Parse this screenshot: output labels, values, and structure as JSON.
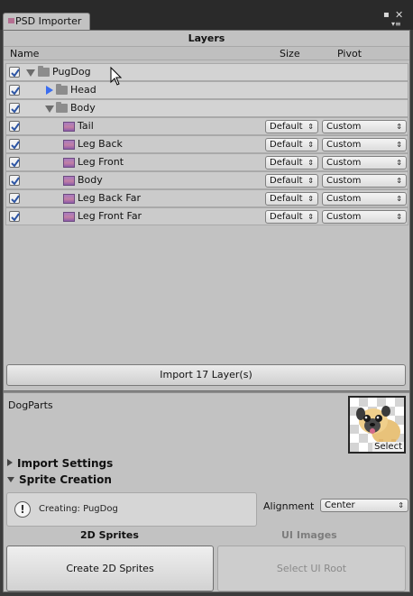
{
  "window": {
    "tab_title": "PSD Importer",
    "menu_icon": "dropdown-menu-icon",
    "maximize_icon": "maximize-icon",
    "close_icon": "close-icon"
  },
  "layers_panel": {
    "title": "Layers",
    "columns": {
      "name": "Name",
      "size": "Size",
      "pivot": "Pivot"
    },
    "rows": [
      {
        "label": "PugDog",
        "checked": true,
        "type": "group",
        "expanded": true
      },
      {
        "label": "Head",
        "checked": true,
        "type": "group",
        "expanded": false
      },
      {
        "label": "Body",
        "checked": true,
        "type": "group",
        "expanded": true
      },
      {
        "label": "Tail",
        "checked": true,
        "type": "layer",
        "size": "Default",
        "pivot": "Custom"
      },
      {
        "label": "Leg Back",
        "checked": true,
        "type": "layer",
        "size": "Default",
        "pivot": "Custom"
      },
      {
        "label": "Leg Front",
        "checked": true,
        "type": "layer",
        "size": "Default",
        "pivot": "Custom"
      },
      {
        "label": "Body",
        "checked": true,
        "type": "layer",
        "size": "Default",
        "pivot": "Custom"
      },
      {
        "label": "Leg Back Far",
        "checked": true,
        "type": "layer",
        "size": "Default",
        "pivot": "Custom"
      },
      {
        "label": "Leg Front Far",
        "checked": true,
        "type": "layer",
        "size": "Default",
        "pivot": "Custom"
      }
    ],
    "import_button": "Import 17 Layer(s)"
  },
  "asset": {
    "name": "DogParts",
    "preview_select": "Select"
  },
  "foldouts": {
    "import_settings": "Import Settings",
    "sprite_creation": "Sprite Creation"
  },
  "sprite_creation": {
    "help_text": "Creating: PugDog",
    "alignment_label": "Alignment",
    "alignment_value": "Center",
    "tab_2d": "2D Sprites",
    "tab_ui": "UI Images",
    "create_button": "Create 2D Sprites",
    "select_root_button": "Select UI Root"
  }
}
